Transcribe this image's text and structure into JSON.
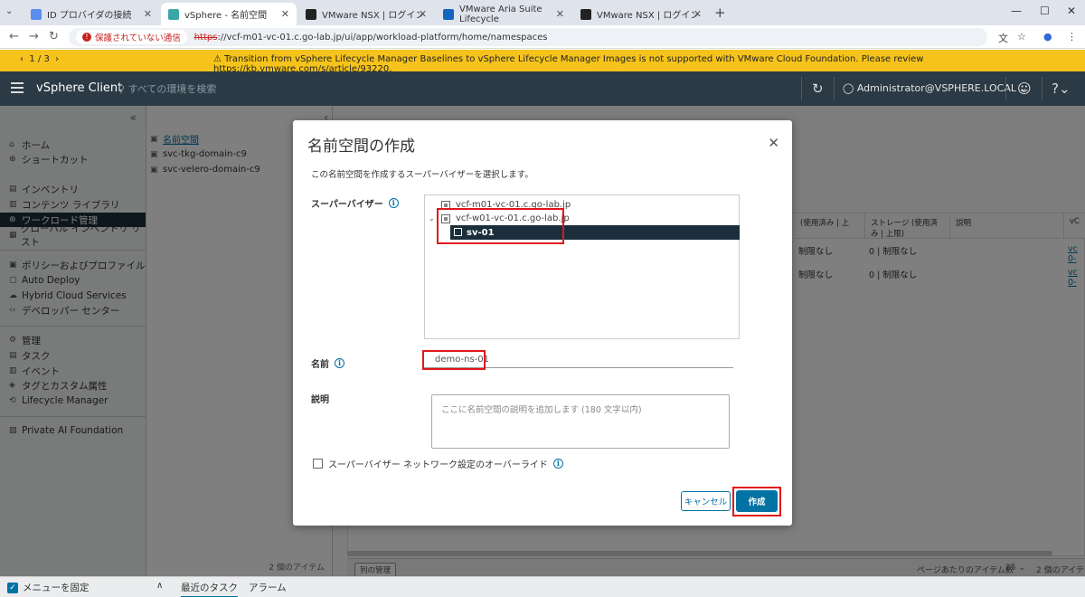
{
  "browser": {
    "tabs": [
      {
        "title": "ID プロバイダの接続",
        "fav_color": "#5a8dee"
      },
      {
        "title": "vSphere - 名前空間",
        "fav_color": "#3aa6a6"
      },
      {
        "title": "VMware NSX | ログイン",
        "fav_color": "#222222"
      },
      {
        "title": "VMware Aria Suite Lifecycle",
        "fav_color": "#1565c0"
      },
      {
        "title": "VMware NSX | ログイン",
        "fav_color": "#222222"
      }
    ],
    "security_warning": "保護されていない通信",
    "url_scheme": "https",
    "url_rest": "://vcf-m01-vc-01.c.go-lab.jp/ui/app/workload-platform/home/namespaces"
  },
  "banner": {
    "pager": "1 / 3",
    "message": "Transition from vSphere Lifecycle Manager Baselines to vSphere Lifecycle Manager Images is not supported with VMware Cloud Foundation. Please review https://kb.vmware.com/s/article/93220."
  },
  "header": {
    "product": "vSphere Client",
    "search_placeholder": "すべての環境を検索",
    "user": "Administrator@VSPHERE.LOCAL"
  },
  "nav": {
    "home": "ホーム",
    "shortcuts": "ショートカット",
    "inventory": "インベントリ",
    "content_library": "コンテンツ ライブラリ",
    "workload_mgmt": "ワークロード管理",
    "global_inventory": "グローバル インベントリ リスト",
    "policies": "ポリシーおよびプロファイル",
    "auto_deploy": "Auto Deploy",
    "hybrid_cloud": "Hybrid Cloud Services",
    "developer_center": "デベロッパー センター",
    "administration": "管理",
    "tasks": "タスク",
    "events": "イベント",
    "tags": "タグとカスタム属性",
    "lifecycle": "Lifecycle Manager",
    "private_ai": "Private AI Foundation"
  },
  "tree": {
    "root": "名前空間",
    "items": [
      "svc-tkg-domain-c9",
      "svc-velero-domain-c9"
    ],
    "count": "2 個のアイテム"
  },
  "bgtable": {
    "headers": [
      "(使用済み | 上",
      "ストレージ (使用済み | 上限)",
      "説明",
      "vC"
    ],
    "rows": [
      {
        "cpu": "制限なし",
        "storage": "0 | 制限なし",
        "link": "vc 0-"
      },
      {
        "cpu": "制限なし",
        "storage": "0 | 制限なし",
        "link": "vc 0-"
      }
    ],
    "column_mgr": "列の管理",
    "per_page_label": "ページあたりのアイテム数",
    "per_page_value": "25",
    "count": "2 個のアイテム"
  },
  "bottom": {
    "pin_menu": "メニューを固定",
    "recent_tasks": "最近のタスク",
    "alarms": "アラーム"
  },
  "modal": {
    "title": "名前空間の作成",
    "instruction": "この名前空間を作成するスーパーバイザーを選択します。",
    "supervisor_label": "スーパーバイザー",
    "tree": {
      "vc1": "vcf-m01-vc-01.c.go-lab.jp",
      "vc2": "vcf-w01-vc-01.c.go-lab.jp",
      "supervisor": "sv-01"
    },
    "name_label": "名前",
    "name_value": "demo-ns-01",
    "desc_label": "説明",
    "desc_placeholder": "ここに名前空間の説明を追加します (180 文字以内)",
    "override_label": "スーパーバイザー ネットワーク設定のオーバーライド",
    "cancel": "キャンセル",
    "create": "作成"
  },
  "colors": {
    "accent": "#0072a3",
    "header_bg": "#2b3a44",
    "banner": "#f5c31b",
    "highlight": "#e0161d"
  }
}
